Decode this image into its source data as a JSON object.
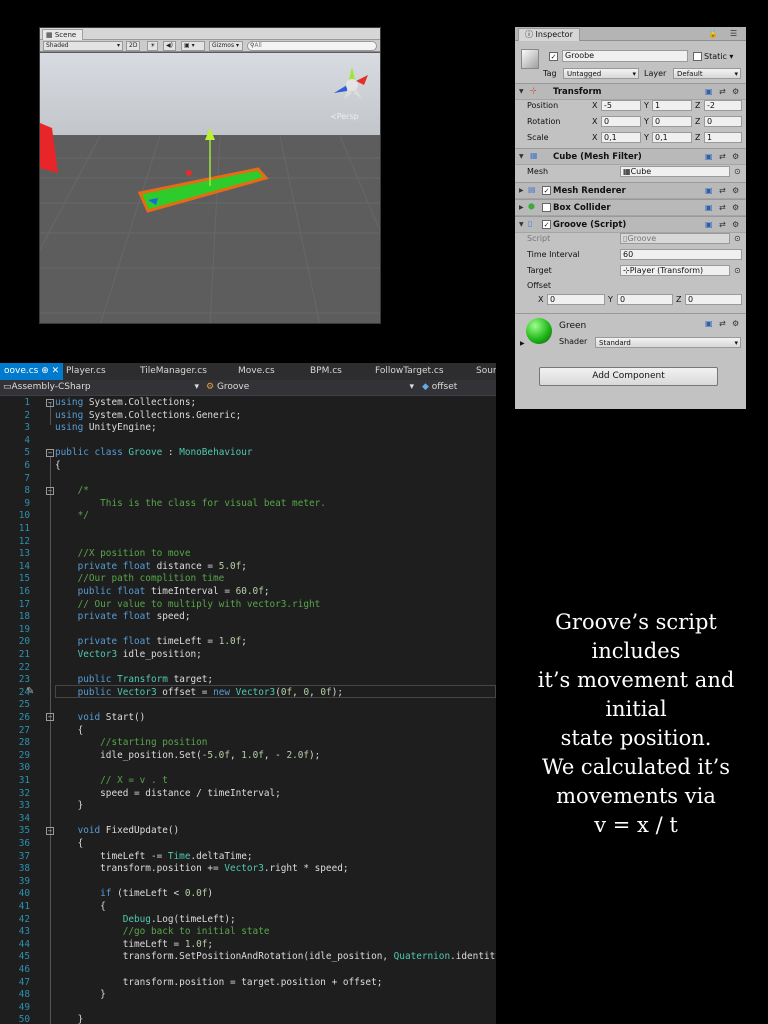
{
  "scene": {
    "tab_label": "Scene",
    "shading_mode": "Shaded",
    "btn_2d": "2D",
    "gizmos_label": "Gizmos",
    "search_placeholder": "All",
    "persp_label": "Persp"
  },
  "inspector": {
    "tab_label": "Inspector",
    "object_name": "Groobe",
    "static_label": "Static",
    "tag_label": "Tag",
    "tag_value": "Untagged",
    "layer_label": "Layer",
    "layer_value": "Default",
    "transform": {
      "title": "Transform",
      "position_label": "Position",
      "rotation_label": "Rotation",
      "scale_label": "Scale",
      "position": {
        "x": "-5",
        "y": "1",
        "z": "-2"
      },
      "rotation": {
        "x": "0",
        "y": "0",
        "z": "0"
      },
      "scale": {
        "x": "0,1",
        "y": "0,1",
        "z": "1"
      }
    },
    "mesh_filter": {
      "title": "Cube (Mesh Filter)",
      "mesh_label": "Mesh",
      "mesh_value": "Cube"
    },
    "mesh_renderer": {
      "title": "Mesh Renderer"
    },
    "box_collider": {
      "title": "Box Collider"
    },
    "script_component": {
      "title": "Groove (Script)",
      "script_label": "Script",
      "script_value": "Groove",
      "time_interval_label": "Time Interval",
      "time_interval_value": "60",
      "target_label": "Target",
      "target_value": "Player (Transform)",
      "offset_label": "Offset",
      "offset": {
        "x": "0",
        "y": "0",
        "z": "0"
      }
    },
    "material": {
      "name": "Green",
      "shader_label": "Shader",
      "shader_value": "Standard"
    },
    "add_component_label": "Add Component",
    "axis_x": "X",
    "axis_y": "Y",
    "axis_z": "Z"
  },
  "editor": {
    "tabs": [
      "oove.cs",
      "Player.cs",
      "TileManager.cs",
      "Move.cs",
      "BPM.cs",
      "FollowTarget.cs",
      "Sour"
    ],
    "nav_project": "Assembly-CSharp",
    "nav_class": "Groove",
    "nav_member": "offset",
    "line_numbers": [
      "1",
      "2",
      "3",
      "4",
      "5",
      "6",
      "7",
      "8",
      "9",
      "10",
      "11",
      "12",
      "13",
      "14",
      "15",
      "16",
      "17",
      "18",
      "19",
      "20",
      "21",
      "22",
      "23",
      "24",
      "25",
      "26",
      "27",
      "28",
      "29",
      "30",
      "31",
      "32",
      "33",
      "34",
      "35",
      "36",
      "37",
      "38",
      "39",
      "40",
      "41",
      "42",
      "43",
      "44",
      "45",
      "46",
      "47",
      "48",
      "49",
      "50"
    ]
  },
  "caption": [
    "Groove’s script",
    "includes",
    "it’s movement and",
    "initial",
    "state position.",
    "We calculated it’s",
    "movements via",
    "v = x / t"
  ]
}
